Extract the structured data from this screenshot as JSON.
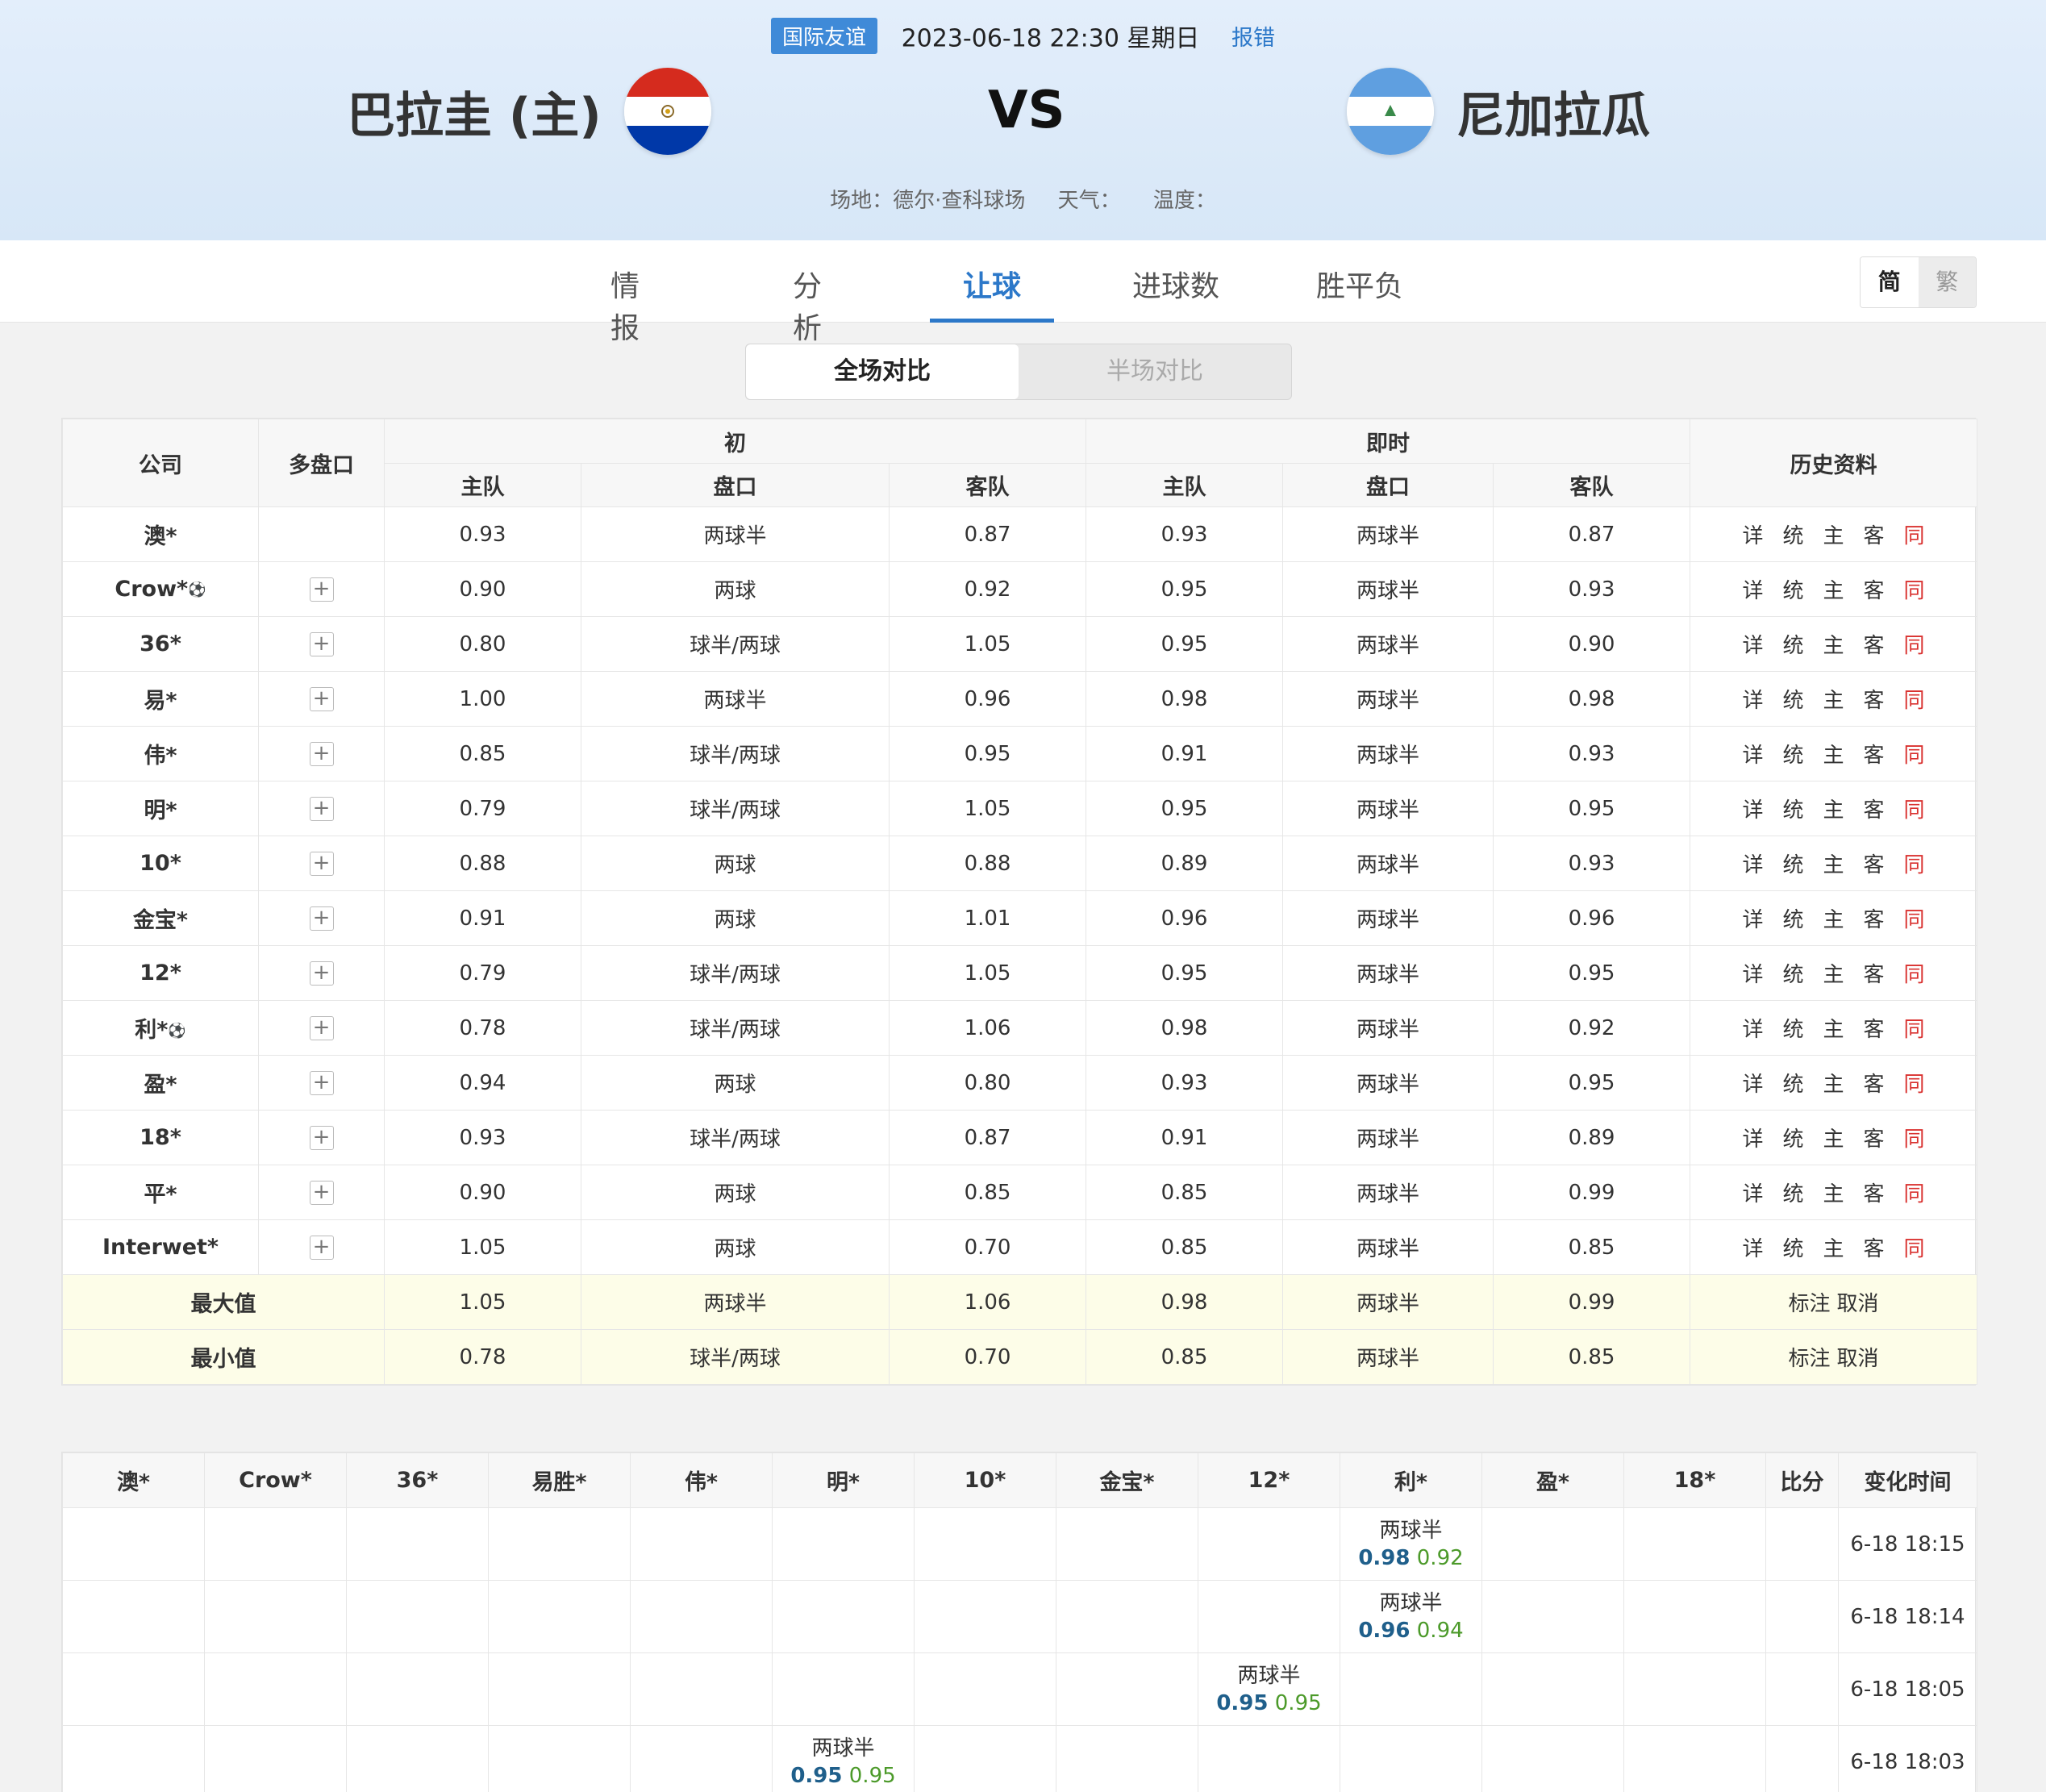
{
  "match": {
    "league": "国际友谊",
    "datetime": "2023-06-18 22:30 星期日",
    "report_label": "报错",
    "home_team": "巴拉圭 (主)",
    "away_team": "尼加拉瓜",
    "vs": "VS",
    "venue_label": "场地：德尔·查科球场",
    "weather_label": "天气：",
    "temp_label": "温度："
  },
  "tabs": [
    "情报",
    "分析",
    "让球",
    "进球数",
    "胜平负"
  ],
  "active_tab": "让球",
  "lang": {
    "simplified": "简",
    "traditional": "繁"
  },
  "segment": {
    "full": "全场对比",
    "half": "半场对比"
  },
  "odds_table": {
    "headers": {
      "company": "公司",
      "multi": "多盘口",
      "initial": "初",
      "live": "即时",
      "history": "历史资料",
      "home": "主队",
      "line": "盘口",
      "away": "客队"
    },
    "history_links": [
      "详",
      "统",
      "主",
      "客",
      "同"
    ],
    "rows": [
      {
        "company": "澳*",
        "ball": false,
        "plus": false,
        "ih": "0.93",
        "il": "两球半",
        "ia": "0.87",
        "lh": "0.93",
        "ll": "两球半",
        "la": "0.87"
      },
      {
        "company": "Crow*",
        "ball": true,
        "plus": true,
        "ih": "0.90",
        "il": "两球",
        "ia": "0.92",
        "lh": "0.95",
        "ll": "两球半",
        "la": "0.93"
      },
      {
        "company": "36*",
        "ball": false,
        "plus": true,
        "ih": "0.80",
        "il": "球半/两球",
        "ia": "1.05",
        "lh": "0.95",
        "ll": "两球半",
        "la": "0.90"
      },
      {
        "company": "易*",
        "ball": false,
        "plus": true,
        "ih": "1.00",
        "il": "两球半",
        "ia": "0.96",
        "lh": "0.98",
        "ll": "两球半",
        "la": "0.98"
      },
      {
        "company": "伟*",
        "ball": false,
        "plus": true,
        "ih": "0.85",
        "il": "球半/两球",
        "ia": "0.95",
        "lh": "0.91",
        "ll": "两球半",
        "la": "0.93"
      },
      {
        "company": "明*",
        "ball": false,
        "plus": true,
        "ih": "0.79",
        "il": "球半/两球",
        "ia": "1.05",
        "lh": "0.95",
        "ll": "两球半",
        "la": "0.95"
      },
      {
        "company": "10*",
        "ball": false,
        "plus": true,
        "ih": "0.88",
        "il": "两球",
        "ia": "0.88",
        "lh": "0.89",
        "ll": "两球半",
        "la": "0.93"
      },
      {
        "company": "金宝*",
        "ball": false,
        "plus": true,
        "ih": "0.91",
        "il": "两球",
        "ia": "1.01",
        "lh": "0.96",
        "ll": "两球半",
        "la": "0.96"
      },
      {
        "company": "12*",
        "ball": false,
        "plus": true,
        "ih": "0.79",
        "il": "球半/两球",
        "ia": "1.05",
        "lh": "0.95",
        "ll": "两球半",
        "la": "0.95"
      },
      {
        "company": "利*",
        "ball": true,
        "plus": true,
        "ih": "0.78",
        "il": "球半/两球",
        "ia": "1.06",
        "lh": "0.98",
        "ll": "两球半",
        "la": "0.92"
      },
      {
        "company": "盈*",
        "ball": false,
        "plus": true,
        "ih": "0.94",
        "il": "两球",
        "ia": "0.80",
        "lh": "0.93",
        "ll": "两球半",
        "la": "0.95"
      },
      {
        "company": "18*",
        "ball": false,
        "plus": true,
        "ih": "0.93",
        "il": "球半/两球",
        "ia": "0.87",
        "lh": "0.91",
        "ll": "两球半",
        "la": "0.89"
      },
      {
        "company": "平*",
        "ball": false,
        "plus": true,
        "ih": "0.90",
        "il": "两球",
        "ia": "0.85",
        "lh": "0.85",
        "ll": "两球半",
        "la": "0.99"
      },
      {
        "company": "Interwet*",
        "ball": false,
        "plus": true,
        "ih": "1.05",
        "il": "两球",
        "ia": "0.70",
        "lh": "0.85",
        "ll": "两球半",
        "la": "0.85"
      }
    ],
    "summary": [
      {
        "label": "最大值",
        "ih": "1.05",
        "il": "两球半",
        "ia": "1.06",
        "lh": "0.98",
        "ll": "两球半",
        "la": "0.99"
      },
      {
        "label": "最小值",
        "ih": "0.78",
        "il": "球半/两球",
        "ia": "0.70",
        "lh": "0.85",
        "ll": "两球半",
        "la": "0.85"
      }
    ],
    "mark_label": "标注",
    "cancel_label": "取消"
  },
  "change_table": {
    "headers": [
      "澳*",
      "Crow*",
      "36*",
      "易胜*",
      "伟*",
      "明*",
      "10*",
      "金宝*",
      "12*",
      "利*",
      "盈*",
      "18*",
      "比分",
      "变化时间"
    ],
    "rows": [
      {
        "col": 9,
        "line": "两球半",
        "home": "0.98",
        "away": "0.92",
        "time": "6-18 18:15"
      },
      {
        "col": 9,
        "line": "两球半",
        "home": "0.96",
        "away": "0.94",
        "time": "6-18 18:14"
      },
      {
        "col": 8,
        "line": "两球半",
        "home": "0.95",
        "away": "0.95",
        "time": "6-18 18:05"
      },
      {
        "col": 5,
        "line": "两球半",
        "home": "0.95",
        "away": "0.95",
        "time": "6-18 18:03"
      }
    ]
  },
  "colors": {
    "accent": "#2c78c9",
    "history_same": "#d9312f",
    "home_value": "#1f5f8b",
    "away_value": "#4c9a2a",
    "summary_bg": "#fdfde8"
  }
}
